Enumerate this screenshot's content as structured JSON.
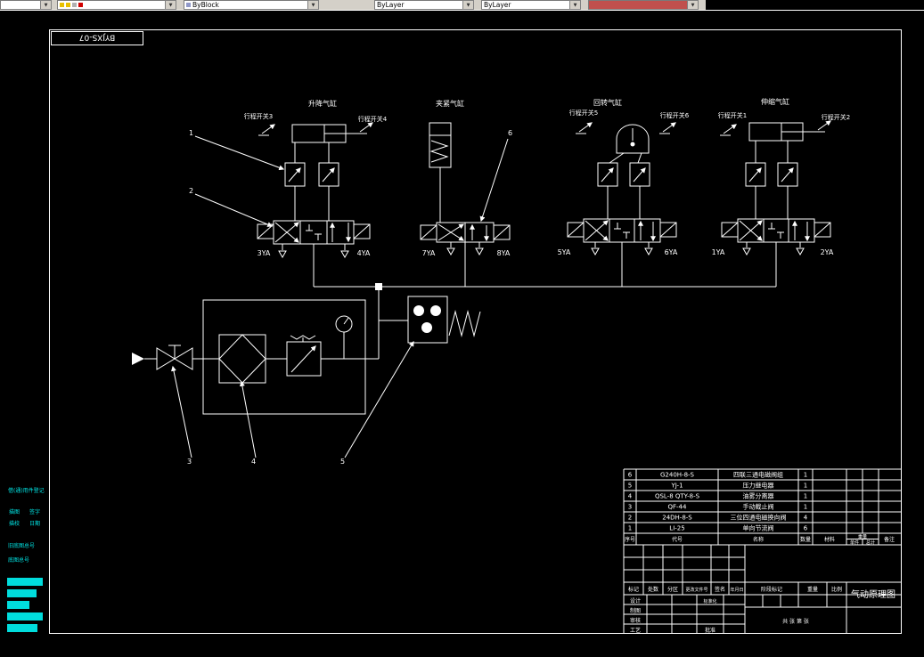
{
  "toolbar": {
    "layer_combo_label": "",
    "color_combo_label": "ByBlock",
    "linetype_combo_label": "ByLayer",
    "lineweight_combo_label": "ByLayer",
    "plotstyle_combo_label": ""
  },
  "drawing": {
    "doc_number": "BYJXS-07",
    "margin": {
      "borrow": "借(通)用件登记",
      "trace": "描图",
      "sign": "签字",
      "proof": "描校",
      "date": "日期",
      "old_base_no": "旧底图总号",
      "base_no": "底图总号"
    },
    "labels": {
      "cyl1": "升降气缸",
      "cyl2": "夹紧气缸",
      "cyl3": "回转气缸",
      "cyl4": "伸缩气缸",
      "sw1": "行程开关1",
      "sw2": "行程开关2",
      "sw3": "行程开关3",
      "sw4": "行程开关4",
      "sw5": "行程开关5",
      "sw6": "行程开关6",
      "ya1": "1YA",
      "ya2": "2YA",
      "ya3": "3YA",
      "ya4": "4YA",
      "ya5": "5YA",
      "ya6": "6YA",
      "ya7": "7YA",
      "ya8": "8YA",
      "ref1": "1",
      "ref2": "2",
      "ref3": "3",
      "ref4": "4",
      "ref5": "5",
      "ref6": "6"
    }
  },
  "title_block": {
    "headers": {
      "no": "序号",
      "code": "代号",
      "name": "名称",
      "qty": "数量",
      "material": "材料",
      "weight": "重量",
      "single": "单件",
      "total": "总计",
      "remark": "备注"
    },
    "parts": [
      {
        "no": "6",
        "code": "G240H-8-S",
        "name": "四联三通电磁阀组",
        "qty": "1"
      },
      {
        "no": "5",
        "code": "YJ-1",
        "name": "压力继电器",
        "qty": "1"
      },
      {
        "no": "4",
        "code": "QSL-8 QTY-8-S",
        "name": "油雾分离器",
        "qty": "1"
      },
      {
        "no": "3",
        "code": "QF-44",
        "name": "手动截止阀",
        "qty": "1"
      },
      {
        "no": "2",
        "code": "24DH-8-S",
        "name": "三位四通电磁换向阀",
        "qty": "4"
      },
      {
        "no": "1",
        "code": "LI-25",
        "name": "单向节流阀",
        "qty": "6"
      }
    ],
    "fields": {
      "mark": "标记",
      "count": "处数",
      "zone": "分区",
      "change_no": "更改文件号",
      "sign": "签名",
      "date": "年月日",
      "design": "设计",
      "draw": "制图",
      "review": "审核",
      "process": "工艺",
      "standard": "标准化",
      "approve": "批准",
      "stage": "阶段标记",
      "weight": "重量",
      "scale": "比例",
      "sheets": "共 张 第 张",
      "title": "气动原理图"
    }
  }
}
